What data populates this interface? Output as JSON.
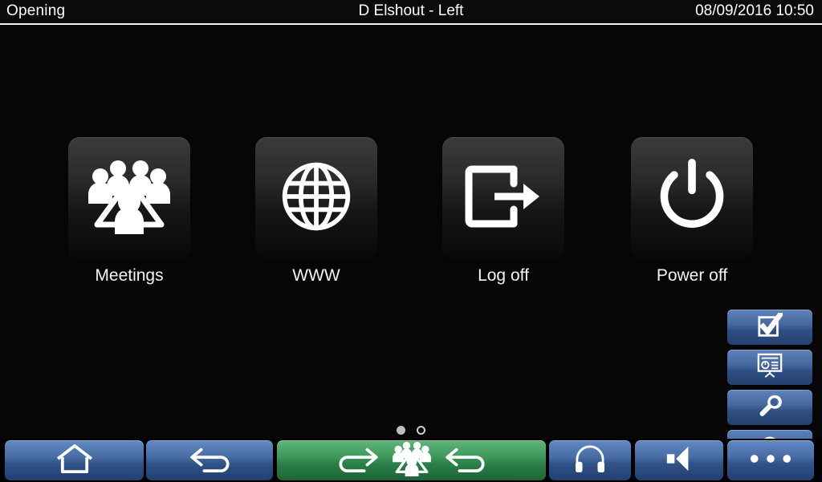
{
  "titlebar": {
    "status": "Opening",
    "user": "D Elshout - Left",
    "datetime": "08/09/2016 10:50"
  },
  "tiles": [
    {
      "label": "Meetings",
      "icon": "meetings-group-icon"
    },
    {
      "label": "WWW",
      "icon": "globe-icon"
    },
    {
      "label": "Log off",
      "icon": "logout-arrow-icon"
    },
    {
      "label": "Power off",
      "icon": "power-icon"
    }
  ],
  "pager": {
    "pages": 2,
    "current": 1,
    "dots": [
      "active",
      "inactive"
    ]
  },
  "side_buttons": [
    {
      "name": "vote-button",
      "icon": "checkbox-check-icon"
    },
    {
      "name": "presentation-button",
      "icon": "presentation-screen-icon"
    },
    {
      "name": "settings-button",
      "icon": "wrench-icon"
    },
    {
      "name": "notify-button",
      "icon": "bell-icon"
    }
  ],
  "bottom_buttons": [
    {
      "name": "home-button",
      "icon": "home-icon",
      "color": "blue"
    },
    {
      "name": "back-button",
      "icon": "back-arrow-icon",
      "color": "blue"
    },
    {
      "name": "meeting-nav-button",
      "icon": "next-meeting-prev-icon",
      "color": "green"
    },
    {
      "name": "headphones-button",
      "icon": "headphones-icon",
      "color": "blue"
    },
    {
      "name": "volume-button",
      "icon": "speaker-icon",
      "color": "blue"
    },
    {
      "name": "more-button",
      "icon": "ellipsis-icon",
      "color": "blue"
    }
  ],
  "colors": {
    "background": "#050505",
    "titlebar": "#0b0b0b",
    "divider": "#f2f2f2",
    "tile": "#2a2a2a",
    "button_blue": "#46699f",
    "button_green": "#3f9a5c",
    "text": "#ffffff"
  }
}
